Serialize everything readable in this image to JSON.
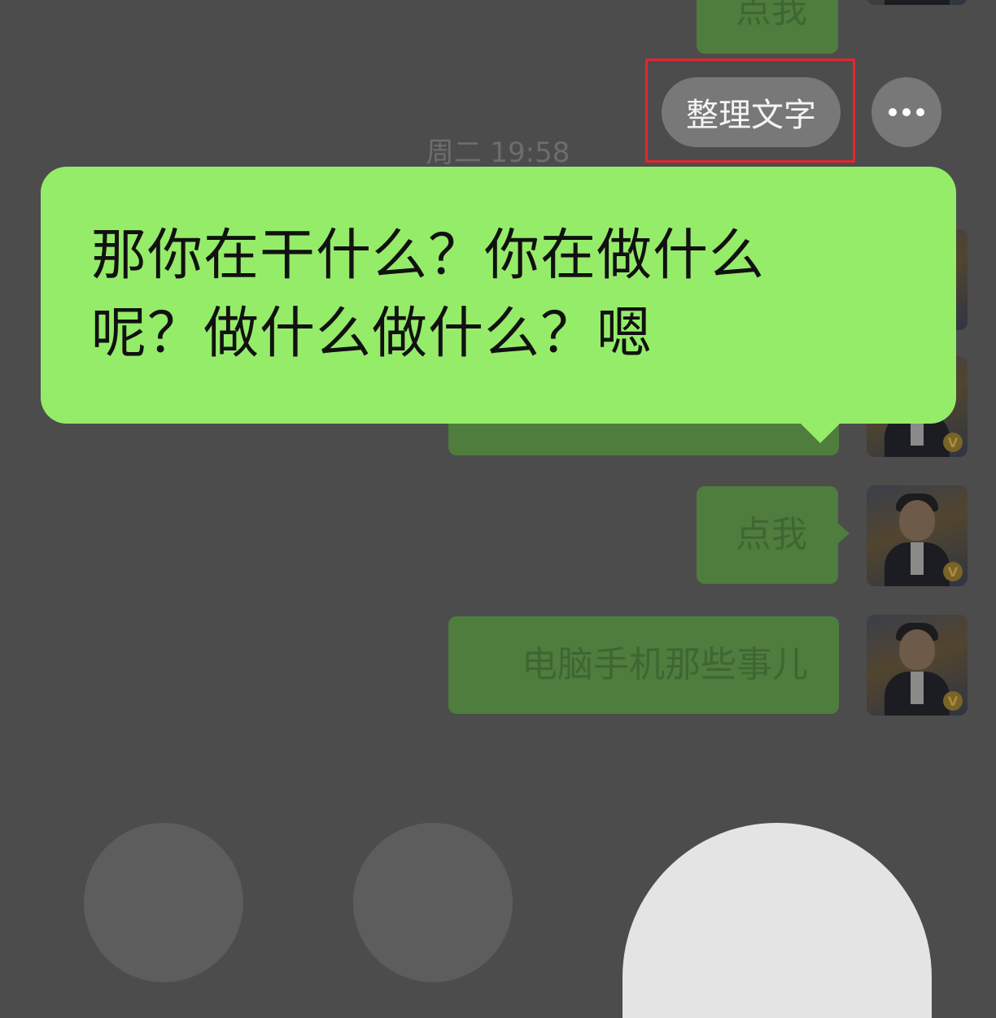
{
  "app": "WeChat",
  "floating_actions": {
    "organize_text_label": "整理文字",
    "more_icon": "more-horizontal-icon"
  },
  "transcription": {
    "line1": "那你在干什么？你在做什么",
    "line2": "呢？做什么做什么？嗯"
  },
  "background_chat": {
    "timestamp": "周二 19:58",
    "messages": [
      {
        "text": "点我",
        "side": "right"
      },
      {
        "text": "",
        "side": "right"
      },
      {
        "text": "点我",
        "side": "right"
      },
      {
        "text": "电脑手机那些事儿",
        "side": "right"
      }
    ],
    "avatar_badge": "V"
  },
  "bottom_controls": {
    "left_button_icon": "cancel-icon",
    "middle_button_icon": "convert-to-text-icon",
    "right_button_icon": "send-voice-icon"
  },
  "colors": {
    "bubble_green": "#95ec69",
    "overlay_gray": "#4c4c4c",
    "highlight_red": "#e3262b"
  }
}
